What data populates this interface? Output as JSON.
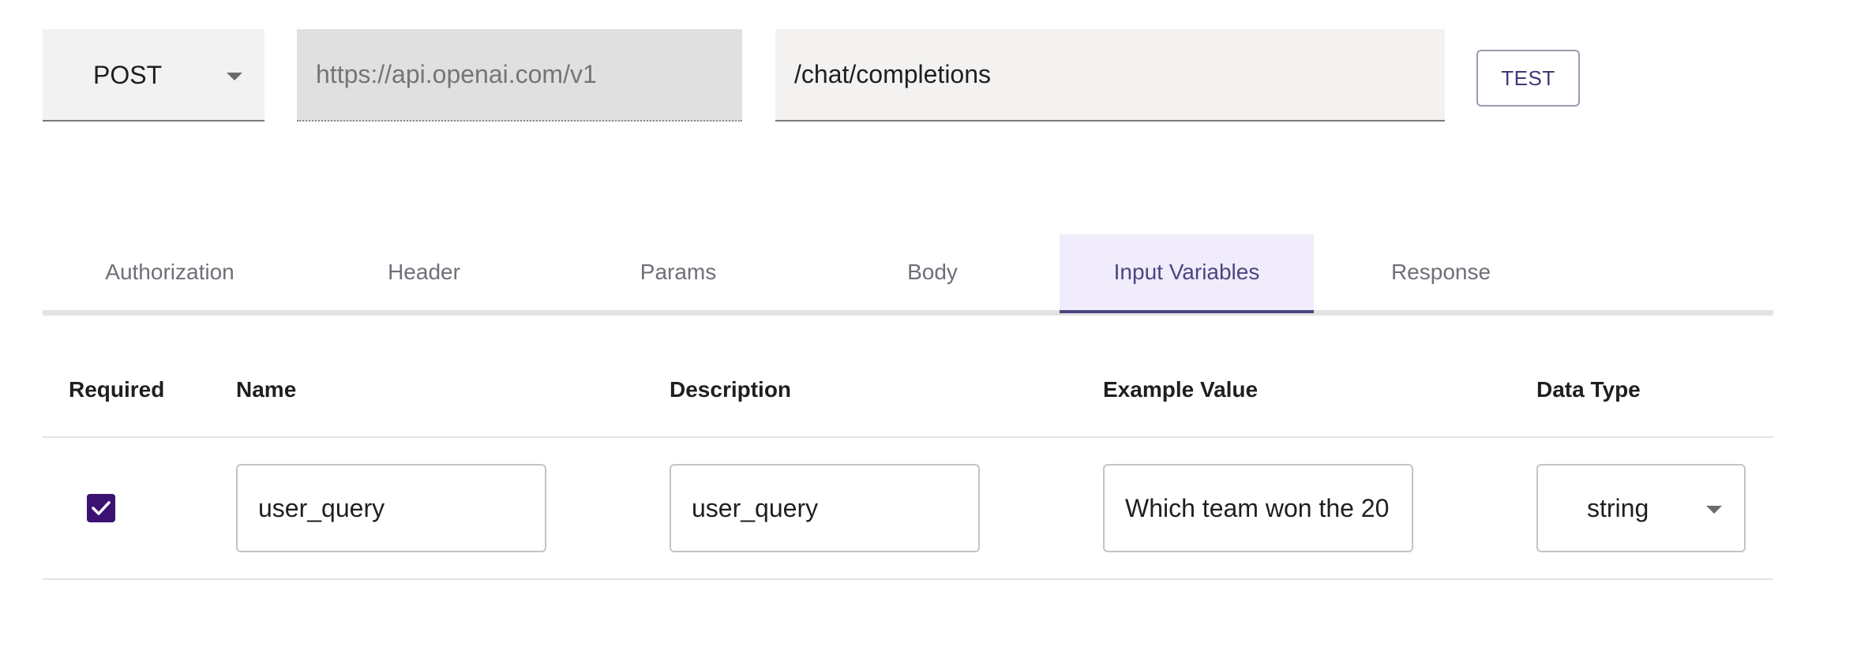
{
  "request": {
    "method": "POST",
    "base_url_placeholder": "https://api.openai.com/v1",
    "path": "/chat/completions",
    "test_label": "TEST"
  },
  "tabs": [
    {
      "label": "Authorization"
    },
    {
      "label": "Header"
    },
    {
      "label": "Params"
    },
    {
      "label": "Body"
    },
    {
      "label": "Input Variables",
      "active": true
    },
    {
      "label": "Response"
    }
  ],
  "table": {
    "headers": {
      "required": "Required",
      "name": "Name",
      "description": "Description",
      "example": "Example Value",
      "data_type": "Data Type"
    },
    "rows": [
      {
        "required": true,
        "name": "user_query",
        "description": "user_query",
        "example": "Which team won the 20",
        "data_type": "string"
      }
    ]
  },
  "colors": {
    "accent": "#4a4680",
    "active_tab_bg": "#f1ecfb",
    "checkbox": "#3b1272"
  },
  "icons": {
    "method_caret": "caret-down-icon",
    "type_caret": "caret-down-icon",
    "checkbox": "checkmark-icon"
  }
}
